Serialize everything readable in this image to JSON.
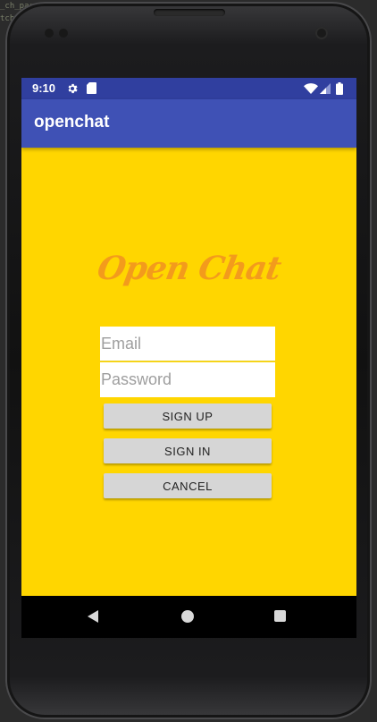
{
  "ide_background": {
    "line1": "_ch_pars",
    "line2": "tch"
  },
  "status_bar": {
    "time": "9:10",
    "icons": [
      "gear-icon",
      "sd-card-icon",
      "wifi-icon",
      "signal-icon",
      "battery-icon"
    ]
  },
  "app_bar": {
    "title": "openchat"
  },
  "logo": {
    "text": "Open Chat"
  },
  "form": {
    "email_placeholder": "Email",
    "email_value": "",
    "password_placeholder": "Password",
    "password_value": ""
  },
  "buttons": {
    "sign_up": "SIGN UP",
    "sign_in": "SIGN IN",
    "cancel": "CANCEL"
  },
  "nav_bar": {
    "icons": [
      "back-icon",
      "home-icon",
      "recents-icon"
    ]
  },
  "colors": {
    "status_bar": "#303f9f",
    "app_bar": "#3f51b5",
    "background": "#ffd600",
    "logo": "#f39b1c",
    "button": "#d6d6d6"
  }
}
